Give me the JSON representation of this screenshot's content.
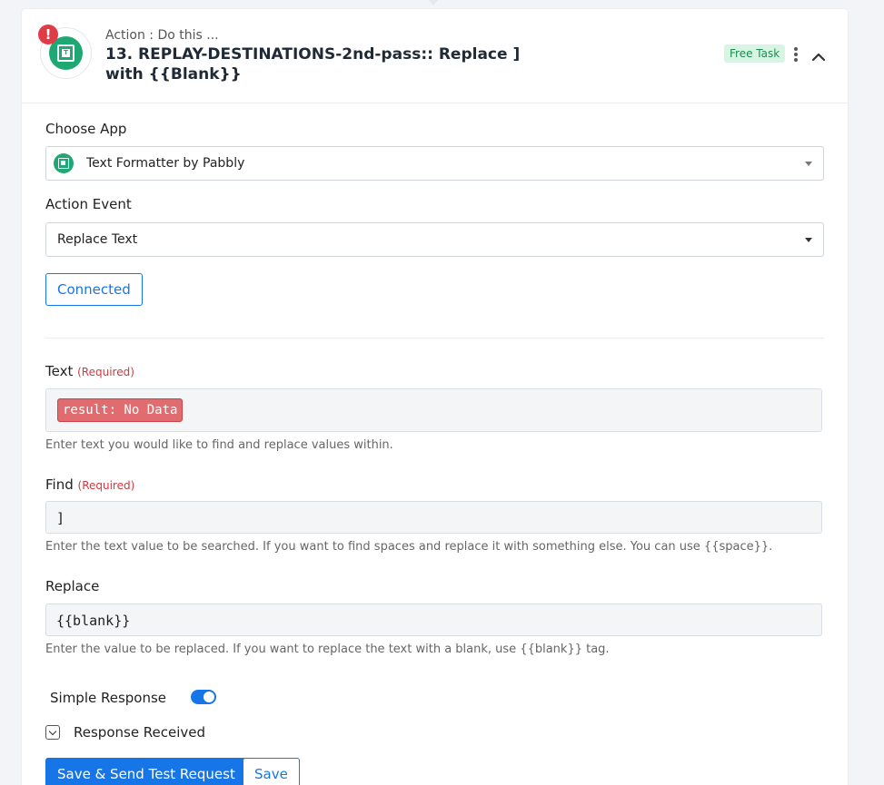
{
  "header": {
    "subtitle": "Action : Do this ...",
    "title": "13. REPLAY-DESTINATIONS-2nd-pass:: Replace ] with {{Blank}}",
    "error_icon": "!",
    "badge": "Free Task",
    "logo_letter": "T",
    "accent_color": "#1fa774",
    "error_color": "#e03c46"
  },
  "choose_app": {
    "label": "Choose App",
    "value": "Text Formatter by Pabbly"
  },
  "action_event": {
    "label": "Action Event",
    "value": "Replace Text"
  },
  "connected_button": "Connected",
  "text_field": {
    "label": "Text",
    "required": "(Required)",
    "tag": "result: No Data",
    "help": "Enter text you would like to find and replace values within."
  },
  "find_field": {
    "label": "Find",
    "required": "(Required)",
    "value": "]",
    "help": "Enter the text value to be searched. If you want to find spaces and replace it with something else. You can use {{space}}."
  },
  "replace_field": {
    "label": "Replace",
    "value": "{{blank}}",
    "help": "Enter the value to be replaced. If you want to replace the text with a blank, use {{blank}} tag."
  },
  "simple_response": {
    "label": "Simple Response",
    "enabled": true
  },
  "response_received": {
    "label": "Response Received"
  },
  "buttons": {
    "save_test": "Save & Send Test Request",
    "save": "Save"
  }
}
